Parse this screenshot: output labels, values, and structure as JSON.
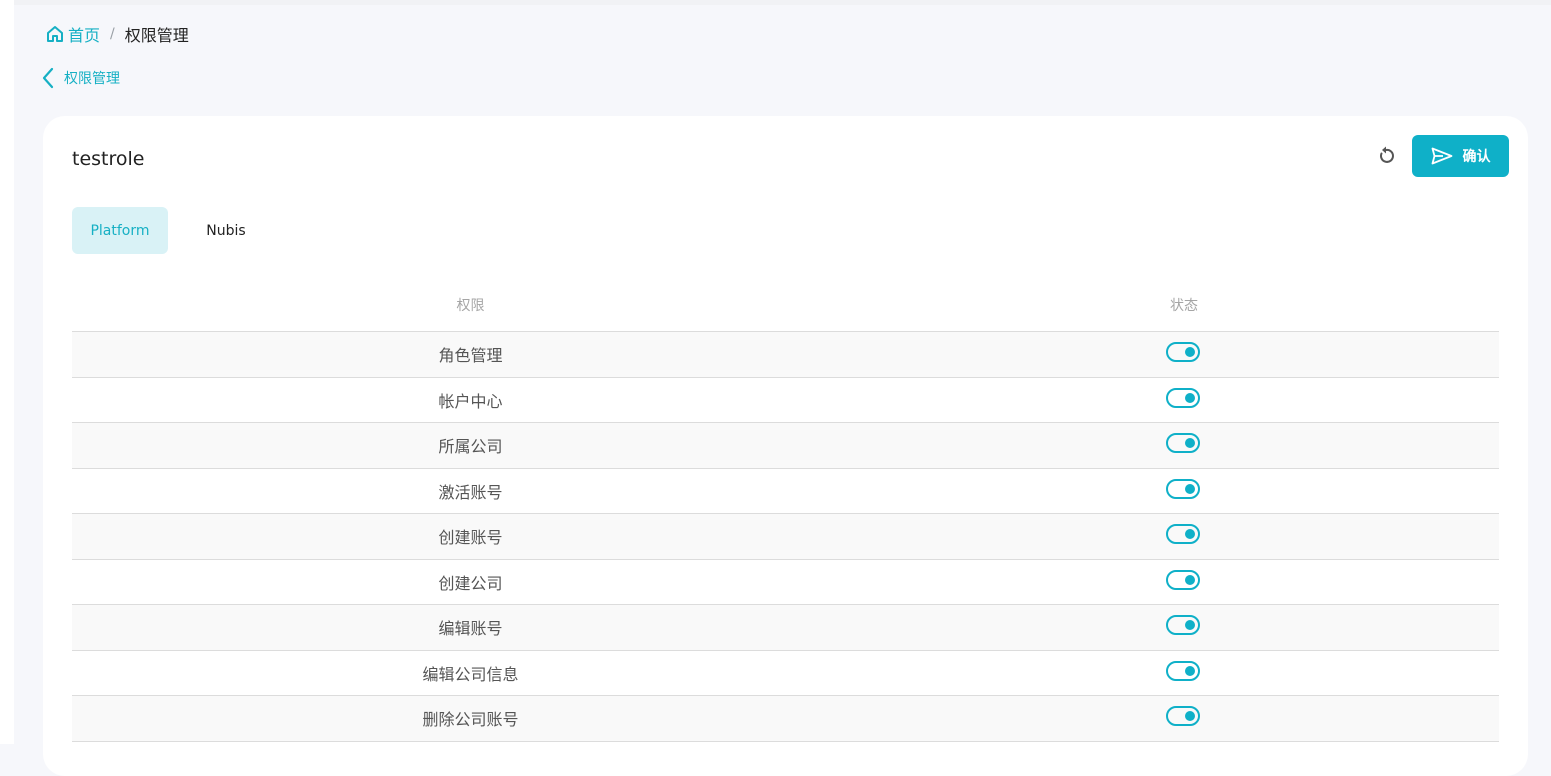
{
  "breadcrumb": {
    "home_label": "首页",
    "separator": "/",
    "current": "权限管理"
  },
  "back_link": {
    "label": "权限管理"
  },
  "role": {
    "name": "testrole"
  },
  "actions": {
    "confirm_label": "确认",
    "reset_icon": "reset-icon",
    "confirm_icon": "send-icon"
  },
  "tabs": [
    {
      "label": "Platform",
      "active": true
    },
    {
      "label": "Nubis",
      "active": false
    }
  ],
  "table": {
    "headers": {
      "permission": "权限",
      "status": "状态"
    },
    "rows": [
      {
        "permission": "角色管理",
        "enabled": true
      },
      {
        "permission": "帐户中心",
        "enabled": true
      },
      {
        "permission": "所属公司",
        "enabled": true
      },
      {
        "permission": "激活账号",
        "enabled": true
      },
      {
        "permission": "创建账号",
        "enabled": true
      },
      {
        "permission": "创建公司",
        "enabled": true
      },
      {
        "permission": "编辑账号",
        "enabled": true
      },
      {
        "permission": "编辑公司信息",
        "enabled": true
      },
      {
        "permission": "删除公司账号",
        "enabled": true
      }
    ]
  },
  "colors": {
    "accent": "#0fb0c8",
    "tab_active_bg": "#d9f2f6",
    "page_bg": "#f6f7fb"
  }
}
